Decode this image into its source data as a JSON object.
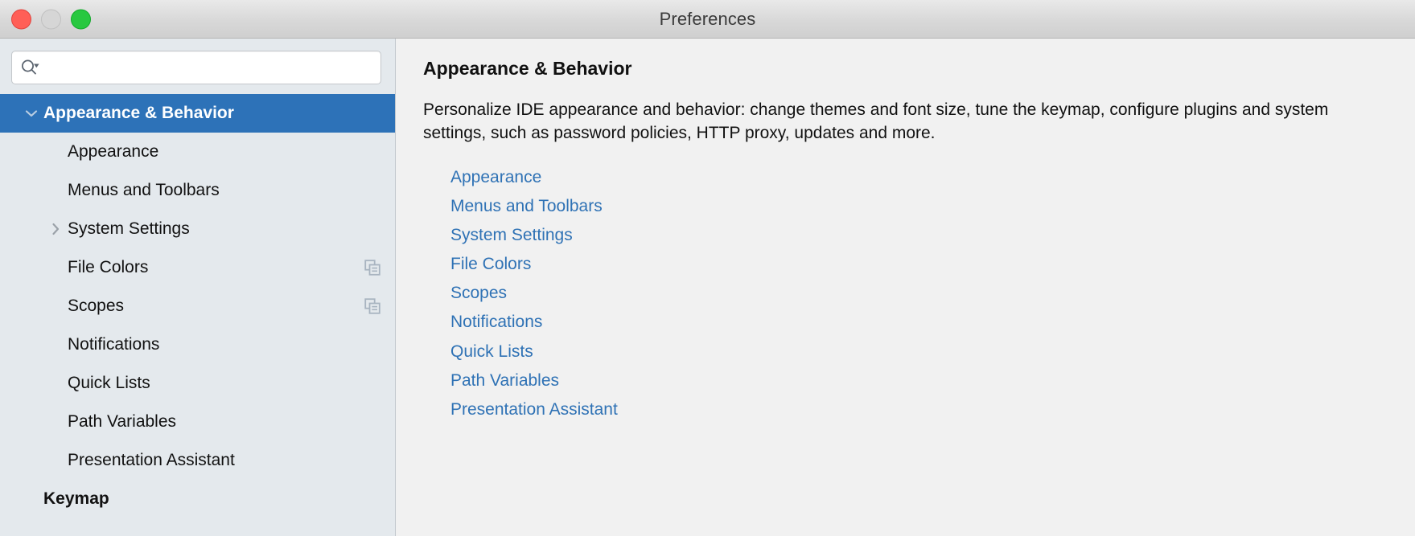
{
  "window": {
    "title": "Preferences",
    "traffic_lights": [
      {
        "name": "close",
        "color": "#ff5f57"
      },
      {
        "name": "minimize",
        "color": "#d6d6d6"
      },
      {
        "name": "zoom",
        "color": "#28c840"
      }
    ]
  },
  "sidebar": {
    "search": {
      "value": "",
      "placeholder": "",
      "icon": "search-icon"
    },
    "items": [
      {
        "label": "Appearance & Behavior",
        "level": 0,
        "selected": true,
        "bold": true,
        "twisty": "chevron-down-icon",
        "trail_icon": null
      },
      {
        "label": "Appearance",
        "level": 1,
        "selected": false,
        "bold": false,
        "twisty": null,
        "trail_icon": null
      },
      {
        "label": "Menus and Toolbars",
        "level": 1,
        "selected": false,
        "bold": false,
        "twisty": null,
        "trail_icon": null
      },
      {
        "label": "System Settings",
        "level": 1,
        "selected": false,
        "bold": false,
        "twisty": "chevron-right-icon",
        "trail_icon": null
      },
      {
        "label": "File Colors",
        "level": 1,
        "selected": false,
        "bold": false,
        "twisty": null,
        "trail_icon": "copy-icon"
      },
      {
        "label": "Scopes",
        "level": 1,
        "selected": false,
        "bold": false,
        "twisty": null,
        "trail_icon": "copy-icon"
      },
      {
        "label": "Notifications",
        "level": 1,
        "selected": false,
        "bold": false,
        "twisty": null,
        "trail_icon": null
      },
      {
        "label": "Quick Lists",
        "level": 1,
        "selected": false,
        "bold": false,
        "twisty": null,
        "trail_icon": null
      },
      {
        "label": "Path Variables",
        "level": 1,
        "selected": false,
        "bold": false,
        "twisty": null,
        "trail_icon": null
      },
      {
        "label": "Presentation Assistant",
        "level": 1,
        "selected": false,
        "bold": false,
        "twisty": null,
        "trail_icon": null
      },
      {
        "label": "Keymap",
        "level": 0,
        "selected": false,
        "bold": true,
        "twisty": null,
        "trail_icon": null
      }
    ]
  },
  "panel": {
    "title": "Appearance & Behavior",
    "description": "Personalize IDE appearance and behavior: change themes and font size, tune the keymap, configure plugins and system settings, such as password policies, HTTP proxy, updates and more.",
    "links": [
      "Appearance",
      "Menus and Toolbars",
      "System Settings",
      "File Colors",
      "Scopes",
      "Notifications",
      "Quick Lists",
      "Path Variables",
      "Presentation Assistant"
    ]
  },
  "colors": {
    "selection_blue": "#2d72b8",
    "link_blue": "#2f72b5",
    "sidebar_bg": "#e4e9ed",
    "panel_bg": "#f1f1f1",
    "titlebar_bg": "#d8d8d8"
  }
}
